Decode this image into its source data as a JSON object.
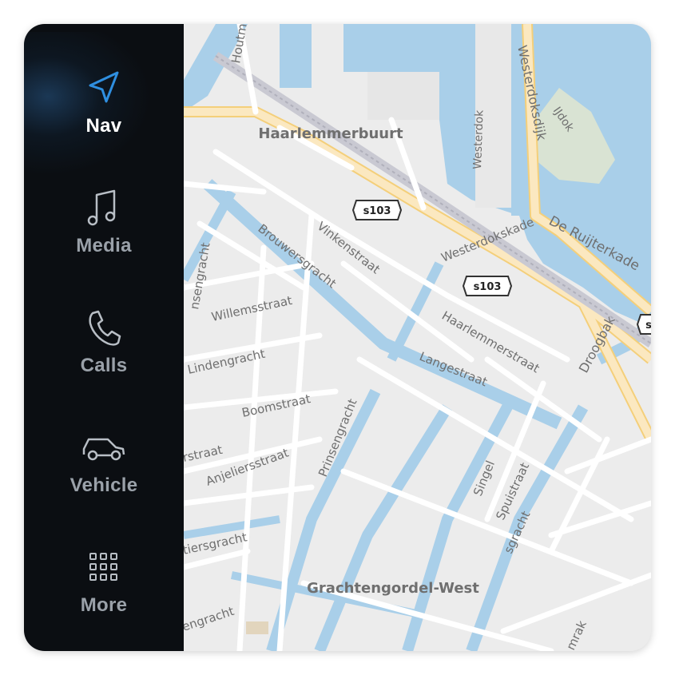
{
  "sidebar": {
    "items": [
      {
        "label": "Nav",
        "icon": "navigation-arrow-icon",
        "active": true
      },
      {
        "label": "Media",
        "icon": "music-note-icon",
        "active": false
      },
      {
        "label": "Calls",
        "icon": "phone-icon",
        "active": false
      },
      {
        "label": "Vehicle",
        "icon": "car-icon",
        "active": false
      },
      {
        "label": "More",
        "icon": "grid-icon",
        "active": false
      }
    ]
  },
  "map": {
    "districts": [
      "Haarlemmerbuurt",
      "Grachtengordel-West"
    ],
    "streets": [
      "Houtm",
      "Westerdoksdijk",
      "IJdok",
      "Westerdok",
      "Westerdokskade",
      "De Ruijterkade",
      "Vinkenstraat",
      "Brouwersgracht",
      "Willemsstraat",
      "Lindengracht",
      "Boomstraat",
      "Anjeliersstraat",
      "Prinsengracht",
      "Haarlemmerstraat",
      "Droogbak",
      "Langestraat",
      "Singel",
      "Spuistraat",
      "sgracht",
      "rstraat",
      "tiersgracht",
      "engracht",
      "nsengracht",
      "mrak"
    ],
    "route_shields": [
      "s103",
      "s103",
      "s"
    ]
  },
  "colors": {
    "sidebar_bg": "#0b0e12",
    "accent": "#2f8fe0",
    "water": "#a9cfe9",
    "land": "#ececec",
    "road": "#ffffff",
    "major_road": "#fbe3b0"
  }
}
